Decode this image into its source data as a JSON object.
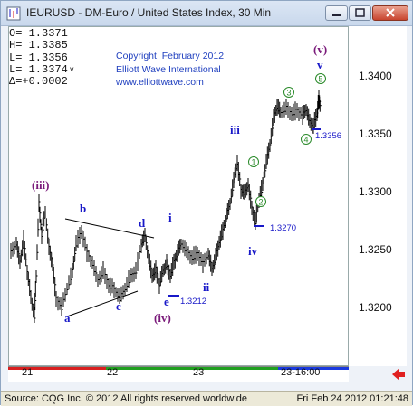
{
  "window": {
    "title": "IEURUSD - DM-Euro / United States Index, 30 Min"
  },
  "ohlc": {
    "open": "O=  1.3371",
    "high": "H=  1.3385",
    "low": "L=  1.3356",
    "last": "L=  1.3374",
    "last_marker": "v",
    "change": "Δ=+0.0002"
  },
  "copyright": {
    "line1": "Copyright, February 2012",
    "line2": "Elliott Wave International",
    "line3": "www.elliottwave.com"
  },
  "wave_labels": {
    "iii_big": "(iii)",
    "a": "a",
    "b": "b",
    "c": "c",
    "d": "d",
    "e": "e",
    "iv_big": "(iv)",
    "i": "i",
    "ii": "ii",
    "iii": "iii",
    "iv": "iv",
    "v": "v",
    "v_big": "(v)",
    "c1": "1",
    "c2": "2",
    "c3": "3",
    "c4": "4",
    "c5": "5"
  },
  "price_labels": {
    "p3212": "1.3212",
    "p3270": "1.3270",
    "p3356": "1.3356"
  },
  "price_axis": {
    "ticks": [
      "1.3400",
      "1.3350",
      "1.3300",
      "1.3250",
      "1.3200"
    ]
  },
  "time_axis": {
    "labels": [
      "21",
      "22",
      "23",
      "23-16:00"
    ]
  },
  "footer": {
    "left": "Source: CQG Inc. © 2012 All rights reserved worldwide",
    "right": "Fri Feb 24 2012 01:21:48"
  },
  "colors": {
    "wave_blue": "#1818c8",
    "wave_purple": "#7a1a7a",
    "circle_green": "#2a8a2a",
    "session_red": "#d82020",
    "session_green": "#20a020",
    "session_blue": "#1a3adf"
  }
}
